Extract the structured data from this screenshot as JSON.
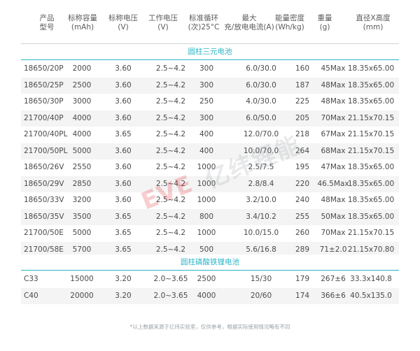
{
  "header": {
    "columns": [
      {
        "l1": "产品",
        "l2": "型号"
      },
      {
        "l1": "标称容量",
        "l2": "(mAh)"
      },
      {
        "l1": "标称电压",
        "l2": "(V)"
      },
      {
        "l1": "工作电压",
        "l2": "(V)"
      },
      {
        "l1": "标准循环",
        "l2": "(次)25°C"
      },
      {
        "l1": "最大",
        "l2": "充/放电电流(A)"
      },
      {
        "l1": "能量密度",
        "l2": "(Wh/kg)"
      },
      {
        "l1": "重量",
        "l2": "(g)"
      },
      {
        "l1": "直径X高度",
        "l2": "(mm)"
      }
    ]
  },
  "sections": {
    "ternary": "圆柱三元电池",
    "lfp": "圆柱磷酸铁锂电池"
  },
  "rows_ternary": [
    [
      "18650/20P",
      "2000",
      "3.60",
      "2.5~4.2",
      "300",
      "6.0/30.0",
      "160",
      "45Max",
      "18.35x65.00"
    ],
    [
      "18650/25P",
      "2500",
      "3.60",
      "2.5~4.2",
      "300",
      "6.0/30.0",
      "187",
      "48Max",
      "18.35x65.00"
    ],
    [
      "18650/30P",
      "3000",
      "3.60",
      "2.5~4.2",
      "250",
      "4.0/30.0",
      "225",
      "48Max",
      "18.35x65.00"
    ],
    [
      "21700/40P",
      "4000",
      "3.60",
      "2.5~4.2",
      "300",
      "6.0/50.0",
      "205",
      "70Max",
      "21.15x70.15"
    ],
    [
      "21700/40PL",
      "4000",
      "3.65",
      "2.5~4.2",
      "400",
      "12.0/70.0",
      "218",
      "67Max",
      "21.15x70.15"
    ],
    [
      "21700/50PL",
      "5000",
      "3.60",
      "2.5~4.2",
      "400",
      "10.0/70.0",
      "264",
      "68Max",
      "21.15x70.15"
    ],
    [
      "18650/26V",
      "2550",
      "3.60",
      "2.5~4.2",
      "1000",
      "2.5/7.5",
      "195",
      "47Max",
      "18.35x65.00"
    ],
    [
      "18650/29V",
      "2850",
      "3.60",
      "2.5~4.2",
      "1000",
      "2.8/8.4",
      "220",
      "46.5Max",
      "18.35x65.00"
    ],
    [
      "18650/33V",
      "3200",
      "3.60",
      "2.5~4.2",
      "1000",
      "3.2/10.0",
      "240",
      "48Max",
      "18.35x65.00"
    ],
    [
      "18650/35V",
      "3500",
      "3.65",
      "2.5~4.2",
      "800",
      "3.4/10.2",
      "255",
      "50Max",
      "18.35x65.00"
    ],
    [
      "21700/50E",
      "5000",
      "3.65",
      "2.5~4.2",
      "1000",
      "10.0/15.0",
      "260",
      "70Max",
      "21.15x70.15"
    ],
    [
      "21700/58E",
      "5700",
      "3.65",
      "2.5~4.2",
      "500",
      "5.6/16.8",
      "289",
      "71±2.0",
      "21.15x70.80"
    ]
  ],
  "rows_lfp": [
    [
      "C33",
      "15000",
      "3.20",
      "2.0~3.65",
      "2500",
      "15/30",
      "179",
      "267±6",
      "33.3x140.8"
    ],
    [
      "C40",
      "20000",
      "3.20",
      "2.0~3.65",
      "4000",
      "20/60",
      "174",
      "366±6",
      "40.5x135.0"
    ]
  ],
  "footnote": "*以上数据来源于亿纬实验室，仅供参考，根据实际使用情况略有不同",
  "watermark": {
    "logo": "EVE",
    "cn": "亿纬锂能"
  }
}
